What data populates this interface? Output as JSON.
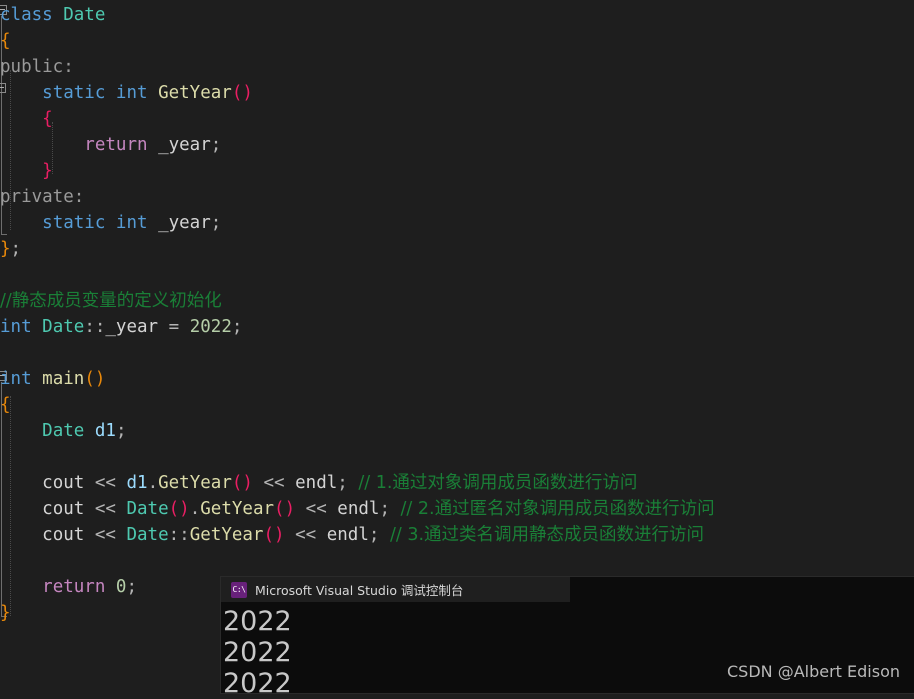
{
  "editor": {
    "background": "#1e1e1e",
    "language": "cpp",
    "lines": [
      {
        "indent": 0,
        "fold": "open-start",
        "tokens": [
          {
            "t": "class",
            "c": "kw"
          },
          {
            "t": " ",
            "c": "plain"
          },
          {
            "t": "Date",
            "c": "type"
          }
        ]
      },
      {
        "indent": 0,
        "fold": "body",
        "tokens": [
          {
            "t": "{",
            "c": "br-o"
          }
        ]
      },
      {
        "indent": 0,
        "fold": "body",
        "tokens": [
          {
            "t": "public",
            "c": "access"
          },
          {
            "t": ":",
            "c": "access"
          }
        ]
      },
      {
        "indent": 1,
        "fold": "open-start2",
        "tokens": [
          {
            "t": "static",
            "c": "kw"
          },
          {
            "t": " ",
            "c": "plain"
          },
          {
            "t": "int",
            "c": "kw"
          },
          {
            "t": " ",
            "c": "plain"
          },
          {
            "t": "GetYear",
            "c": "fn"
          },
          {
            "t": "()",
            "c": "br-p"
          }
        ]
      },
      {
        "indent": 1,
        "fold": "body2",
        "tokens": [
          {
            "t": "{",
            "c": "br-p"
          }
        ]
      },
      {
        "indent": 2,
        "fold": "body2",
        "tokens": [
          {
            "t": "return",
            "c": "ctrl"
          },
          {
            "t": " ",
            "c": "plain"
          },
          {
            "t": "_year",
            "c": "plain"
          },
          {
            "t": ";",
            "c": "op"
          }
        ]
      },
      {
        "indent": 1,
        "fold": "end2",
        "tokens": [
          {
            "t": "}",
            "c": "br-p"
          }
        ]
      },
      {
        "indent": 0,
        "fold": "body",
        "tokens": [
          {
            "t": "private",
            "c": "access"
          },
          {
            "t": ":",
            "c": "access"
          }
        ]
      },
      {
        "indent": 1,
        "fold": "body",
        "tokens": [
          {
            "t": "static",
            "c": "kw"
          },
          {
            "t": " ",
            "c": "plain"
          },
          {
            "t": "int",
            "c": "kw"
          },
          {
            "t": " ",
            "c": "plain"
          },
          {
            "t": "_year",
            "c": "plain"
          },
          {
            "t": ";",
            "c": "op"
          }
        ]
      },
      {
        "indent": 0,
        "fold": "end",
        "tokens": [
          {
            "t": "}",
            "c": "br-o"
          },
          {
            "t": ";",
            "c": "op"
          }
        ]
      },
      {
        "indent": 0,
        "fold": "none",
        "tokens": []
      },
      {
        "indent": 0,
        "fold": "none",
        "tokens": [
          {
            "t": "//静态成员变量的定义初始化",
            "c": "cmt cn"
          }
        ]
      },
      {
        "indent": 0,
        "fold": "none",
        "tokens": [
          {
            "t": "int",
            "c": "kw"
          },
          {
            "t": " ",
            "c": "plain"
          },
          {
            "t": "Date",
            "c": "type"
          },
          {
            "t": "::",
            "c": "op"
          },
          {
            "t": "_year",
            "c": "plain"
          },
          {
            "t": " ",
            "c": "plain"
          },
          {
            "t": "=",
            "c": "op"
          },
          {
            "t": " ",
            "c": "plain"
          },
          {
            "t": "2022",
            "c": "num"
          },
          {
            "t": ";",
            "c": "op"
          }
        ]
      },
      {
        "indent": 0,
        "fold": "none",
        "tokens": []
      },
      {
        "indent": 0,
        "fold": "open-start3",
        "tokens": [
          {
            "t": "int",
            "c": "kw"
          },
          {
            "t": " ",
            "c": "plain"
          },
          {
            "t": "main",
            "c": "fn"
          },
          {
            "t": "()",
            "c": "br-o"
          }
        ]
      },
      {
        "indent": 0,
        "fold": "body3",
        "tokens": [
          {
            "t": "{",
            "c": "br-o"
          }
        ]
      },
      {
        "indent": 1,
        "fold": "body3",
        "tokens": [
          {
            "t": "Date",
            "c": "type"
          },
          {
            "t": " ",
            "c": "plain"
          },
          {
            "t": "d1",
            "c": "var"
          },
          {
            "t": ";",
            "c": "op"
          }
        ]
      },
      {
        "indent": 1,
        "fold": "body3",
        "tokens": []
      },
      {
        "indent": 1,
        "fold": "body3",
        "tokens": [
          {
            "t": "cout",
            "c": "plain"
          },
          {
            "t": " ",
            "c": "plain"
          },
          {
            "t": "<<",
            "c": "op"
          },
          {
            "t": " ",
            "c": "plain"
          },
          {
            "t": "d1",
            "c": "var"
          },
          {
            "t": ".",
            "c": "op"
          },
          {
            "t": "GetYear",
            "c": "fn"
          },
          {
            "t": "()",
            "c": "br-p"
          },
          {
            "t": " ",
            "c": "plain"
          },
          {
            "t": "<<",
            "c": "op"
          },
          {
            "t": " ",
            "c": "plain"
          },
          {
            "t": "endl",
            "c": "plain"
          },
          {
            "t": ";",
            "c": "op"
          },
          {
            "t": " ",
            "c": "plain"
          },
          {
            "t": "// 1.通过对象调用成员函数进行访问",
            "c": "cmt cn"
          }
        ]
      },
      {
        "indent": 1,
        "fold": "body3",
        "tokens": [
          {
            "t": "cout",
            "c": "plain"
          },
          {
            "t": " ",
            "c": "plain"
          },
          {
            "t": "<<",
            "c": "op"
          },
          {
            "t": " ",
            "c": "plain"
          },
          {
            "t": "Date",
            "c": "type"
          },
          {
            "t": "()",
            "c": "br-p"
          },
          {
            "t": ".",
            "c": "op"
          },
          {
            "t": "GetYear",
            "c": "fn"
          },
          {
            "t": "()",
            "c": "br-p"
          },
          {
            "t": " ",
            "c": "plain"
          },
          {
            "t": "<<",
            "c": "op"
          },
          {
            "t": " ",
            "c": "plain"
          },
          {
            "t": "endl",
            "c": "plain"
          },
          {
            "t": ";",
            "c": "op"
          },
          {
            "t": " ",
            "c": "plain"
          },
          {
            "t": "// 2.通过匿名对象调用成员函数进行访问",
            "c": "cmt cn"
          }
        ]
      },
      {
        "indent": 1,
        "fold": "body3",
        "tokens": [
          {
            "t": "cout",
            "c": "plain"
          },
          {
            "t": " ",
            "c": "plain"
          },
          {
            "t": "<<",
            "c": "op"
          },
          {
            "t": " ",
            "c": "plain"
          },
          {
            "t": "Date",
            "c": "type"
          },
          {
            "t": "::",
            "c": "op"
          },
          {
            "t": "GetYear",
            "c": "fn"
          },
          {
            "t": "()",
            "c": "br-p"
          },
          {
            "t": " ",
            "c": "plain"
          },
          {
            "t": "<<",
            "c": "op"
          },
          {
            "t": " ",
            "c": "plain"
          },
          {
            "t": "endl",
            "c": "plain"
          },
          {
            "t": ";",
            "c": "op"
          },
          {
            "t": " ",
            "c": "plain"
          },
          {
            "t": "// 3.通过类名调用静态成员函数进行访问",
            "c": "cmt cn"
          }
        ]
      },
      {
        "indent": 1,
        "fold": "body3",
        "tokens": []
      },
      {
        "indent": 1,
        "fold": "body3",
        "tokens": [
          {
            "t": "return",
            "c": "ctrl"
          },
          {
            "t": " ",
            "c": "plain"
          },
          {
            "t": "0",
            "c": "num"
          },
          {
            "t": ";",
            "c": "op"
          }
        ]
      },
      {
        "indent": 0,
        "fold": "end3",
        "tokens": [
          {
            "t": "}",
            "c": "br-o"
          }
        ]
      }
    ]
  },
  "console": {
    "icon": "console-window-icon",
    "icon_glyph": "C:\\",
    "title": "Microsoft Visual Studio 调试控制台",
    "output_lines": [
      "2022",
      "2022",
      "2022"
    ],
    "background": "#0c0c0c",
    "titlebar_background": "#1f1f1f"
  },
  "watermark": {
    "text": "CSDN @Albert Edison"
  }
}
